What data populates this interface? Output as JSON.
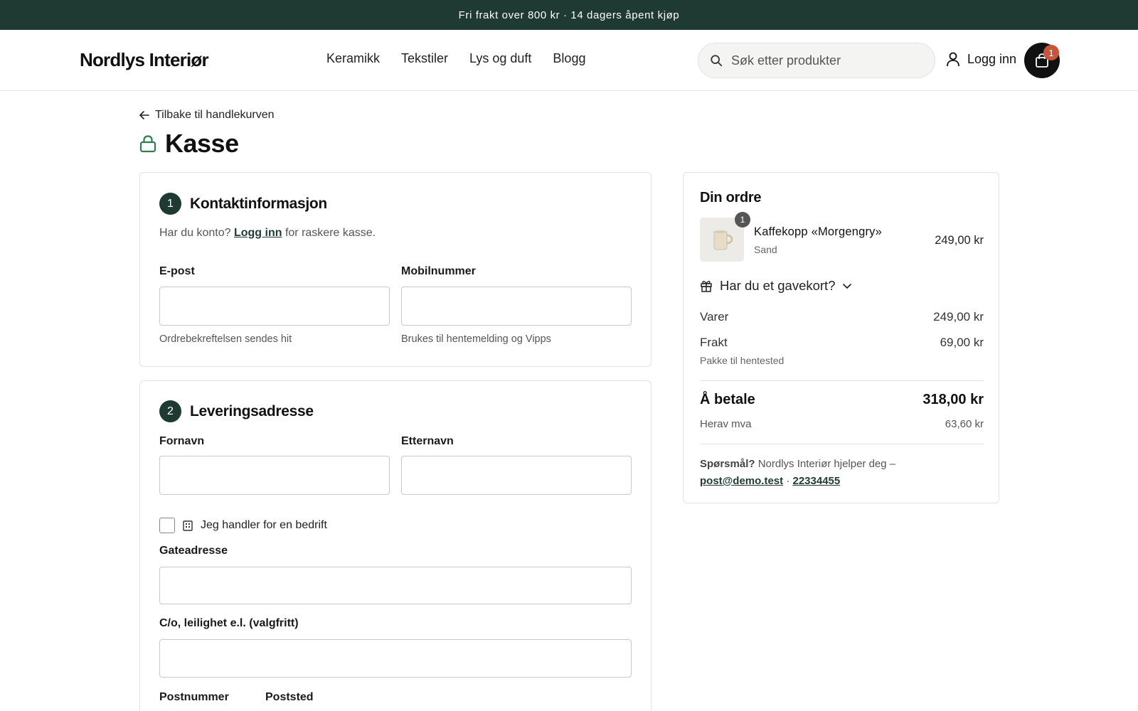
{
  "promo": {
    "text": "Fri frakt over 800 kr · 14 dagers åpent kjøp"
  },
  "header": {
    "logo": "Nordlys Interiør",
    "nav": [
      "Keramikk",
      "Tekstiler",
      "Lys og duft",
      "Blogg"
    ],
    "search_placeholder": "Søk etter produkter",
    "login_label": "Logg inn",
    "cart_count": "1"
  },
  "page": {
    "back_label": "Tilbake til handlekurven",
    "title": "Kasse"
  },
  "contact": {
    "step": "1",
    "title": "Kontaktinformasjon",
    "account_prefix": "Har du konto?",
    "account_link": "Logg inn",
    "account_suffix": "for raskere kasse.",
    "email_label": "E-post",
    "email_help": "Ordrebekreftelsen sendes hit",
    "phone_label": "Mobilnummer",
    "phone_help": "Brukes til hentemelding og Vipps"
  },
  "delivery": {
    "step": "2",
    "title": "Leveringsadresse",
    "firstname_label": "Fornavn",
    "lastname_label": "Etternavn",
    "business_label": "Jeg handler for en bedrift",
    "street_label": "Gateadresse",
    "co_label": "C/o, leilighet e.l. (valgfritt)",
    "postcode_label": "Postnummer",
    "city_label": "Poststed"
  },
  "order": {
    "title": "Din ordre",
    "item": {
      "name": "Kaffekopp «Morgengry»",
      "variant": "Sand",
      "price": "249,00 kr",
      "qty": "1"
    },
    "gift_label": "Har du et gavekort?",
    "items_label": "Varer",
    "items_value": "249,00 kr",
    "shipping_label": "Frakt",
    "shipping_value": "69,00 kr",
    "shipping_note": "Pakke til hentested",
    "total_label": "Å betale",
    "total_value": "318,00 kr",
    "vat_label": "Herav mva",
    "vat_value": "63,60 kr",
    "help_prefix": "Spørsmål?",
    "help_text": "Nordlys Interiør hjelper deg –",
    "help_email": "post@demo.test",
    "help_sep": "·",
    "help_phone": "22334455"
  },
  "colors": {
    "brand_dark": "#1e3a33",
    "badge": "#c8553a",
    "lock": "#2e7d4f"
  },
  "icons": [
    "search-icon",
    "user-icon",
    "bag-icon",
    "arrow-left-icon",
    "lock-icon",
    "gift-icon",
    "chevron-down-icon",
    "building-icon",
    "mug-icon"
  ]
}
